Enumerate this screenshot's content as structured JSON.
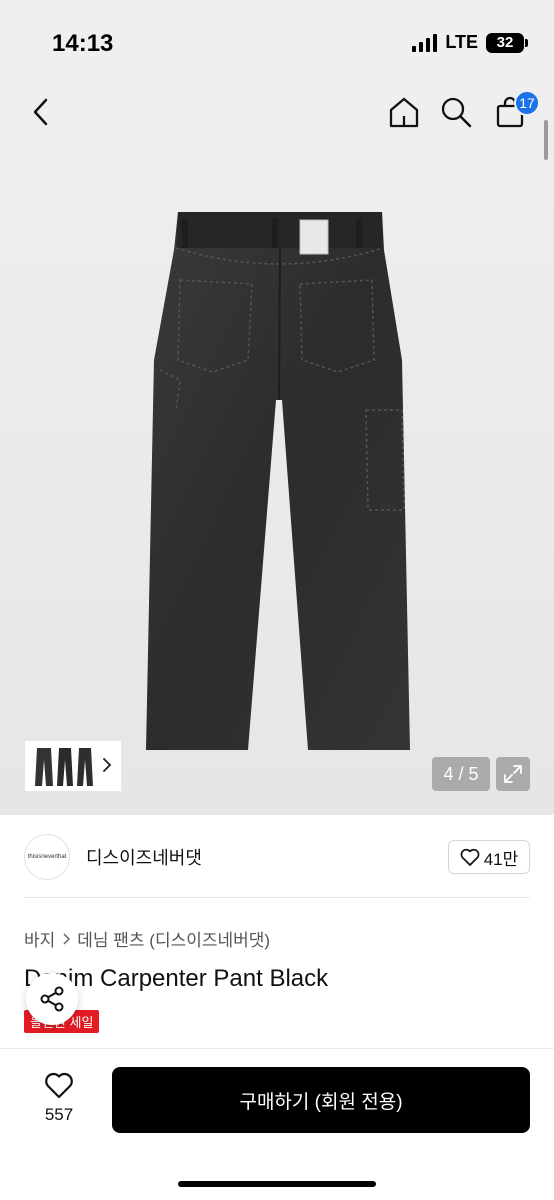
{
  "status": {
    "time": "14:13",
    "network": "LTE",
    "battery": "32"
  },
  "nav": {
    "cart_count": "17"
  },
  "gallery": {
    "counter": "4 / 5"
  },
  "brand": {
    "logo_text": "thisisneverthat",
    "name": "디스이즈네버댓",
    "likes": "41만"
  },
  "breadcrumb": {
    "level1": "바지",
    "level2": "데님 팬츠 (디스이즈네버댓)"
  },
  "product": {
    "title": "Denim Carpenter Pant Black",
    "sale_badge": "올인원 세일"
  },
  "bottom": {
    "wish_count": "557",
    "buy_label": "구매하기 (회원 전용)"
  },
  "colors": {
    "accent": "#1a73e8",
    "sale": "#e31b23",
    "button": "#000000"
  }
}
